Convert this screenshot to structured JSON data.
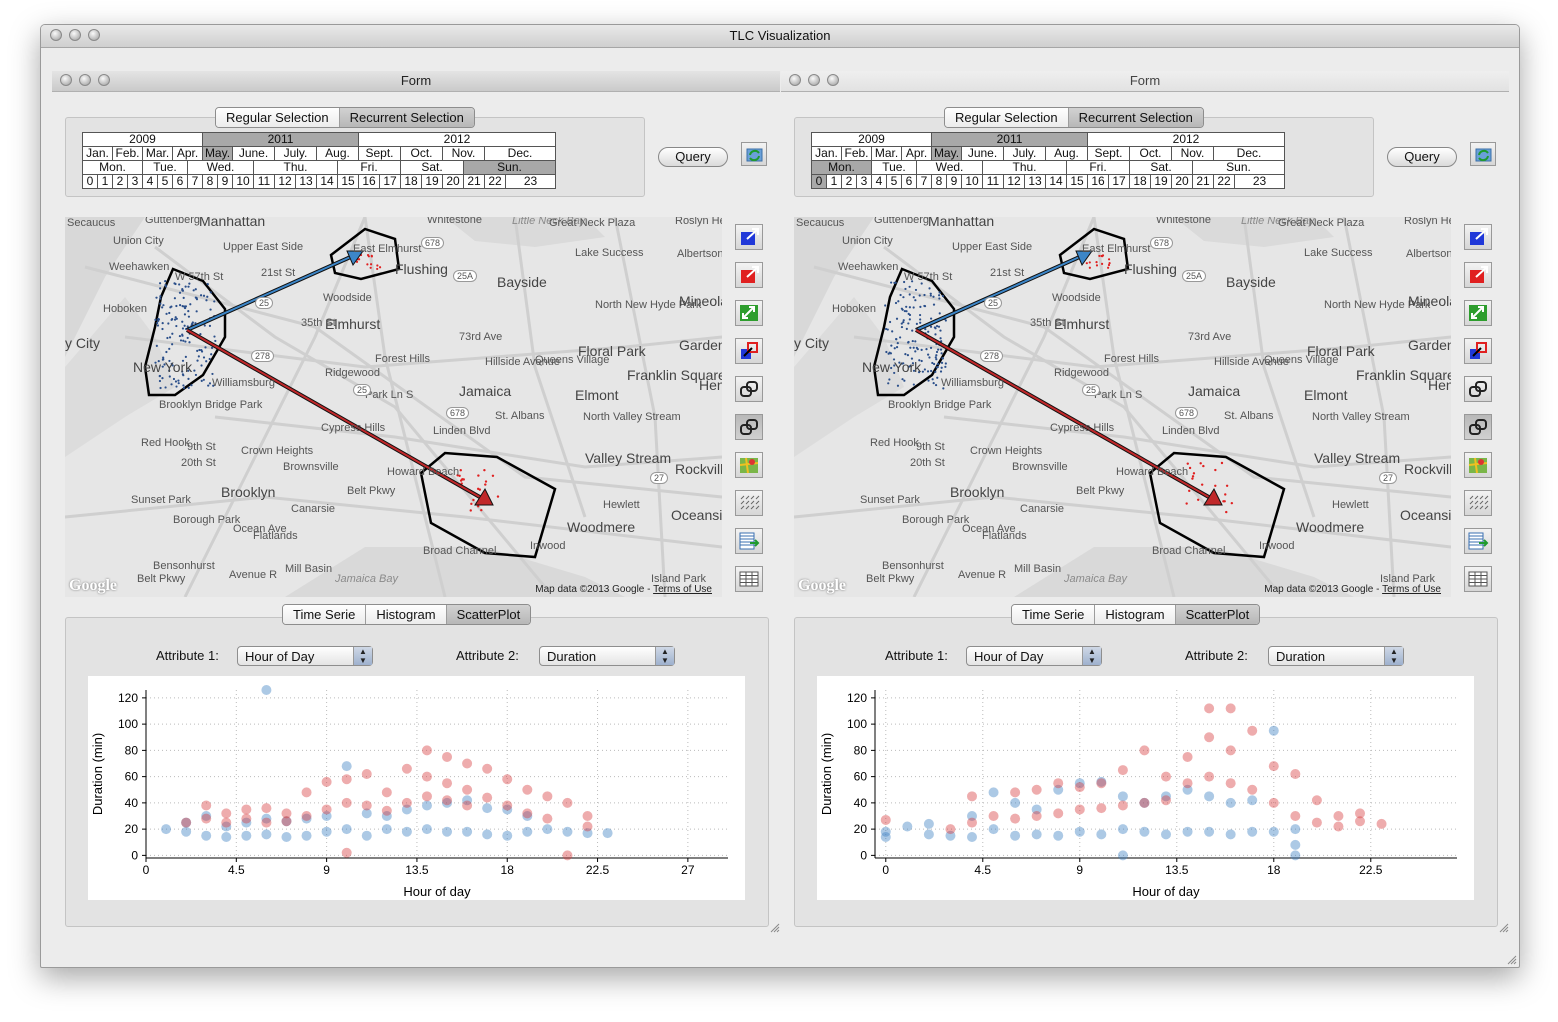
{
  "app": {
    "title": "TLC Visualization"
  },
  "forms": [
    {
      "title": "Form",
      "selection_tabs": [
        "Regular Selection",
        "Recurrent Selection"
      ],
      "active_selection_tab": 1,
      "years": [
        "2009",
        "2011",
        "2012"
      ],
      "selected_years": [
        1
      ],
      "months": [
        "Jan.",
        "Feb.",
        "Mar.",
        "Apr.",
        "May.",
        "June.",
        "July.",
        "Aug.",
        "Sept.",
        "Oct.",
        "Nov.",
        "Dec."
      ],
      "selected_months": [
        4
      ],
      "weekdays": [
        "Mon.",
        "Tue.",
        "Wed.",
        "Thu.",
        "Fri.",
        "Sat.",
        "Sun."
      ],
      "selected_weekdays": [
        6
      ],
      "hours": [
        "0",
        "1",
        "2",
        "3",
        "4",
        "5",
        "6",
        "7",
        "8",
        "9",
        "10",
        "11",
        "12",
        "13",
        "14",
        "15",
        "16",
        "17",
        "18",
        "19",
        "20",
        "21",
        "22",
        "23"
      ],
      "selected_hours": [],
      "query_label": "Query",
      "chart_tabs": [
        "Time Serie",
        "Histogram",
        "ScatterPlot"
      ],
      "active_chart_tab": 2,
      "attribute1_label": "Attribute 1:",
      "attribute1_value": "Hour of Day",
      "attribute2_label": "Attribute 2:",
      "attribute2_value": "Duration",
      "chart_data": {
        "type": "scatter",
        "xlabel": "Hour of day",
        "ylabel": "Duration (min)",
        "xlim": [
          0,
          29
        ],
        "ylim": [
          -2,
          126
        ],
        "xticks": [
          "0",
          "4.5",
          "9",
          "13.5",
          "18",
          "22.5",
          "27"
        ],
        "yticks": [
          "0",
          "20",
          "40",
          "60",
          "80",
          "100",
          "120"
        ],
        "grid": true,
        "series": [
          {
            "color": "#3a7fc1",
            "x": [
              1,
              2,
              2,
              3,
              3,
              4,
              4,
              5,
              5,
              6,
              6,
              6,
              7,
              7,
              8,
              8,
              9,
              9,
              10,
              10,
              11,
              11,
              12,
              12,
              13,
              13,
              14,
              14,
              15,
              15,
              16,
              16,
              17,
              17,
              18,
              18,
              19,
              19,
              20,
              21,
              22,
              23
            ],
            "y": [
              20,
              18,
              25,
              15,
              30,
              14,
              22,
              15,
              25,
              126,
              16,
              28,
              14,
              26,
              15,
              28,
              18,
              30,
              20,
              68,
              15,
              32,
              20,
              30,
              18,
              35,
              20,
              38,
              18,
              40,
              18,
              42,
              16,
              36,
              15,
              35,
              18,
              30,
              20,
              18,
              17,
              17
            ]
          },
          {
            "color": "#d6393c",
            "x": [
              2,
              3,
              3,
              4,
              4,
              5,
              5,
              6,
              6,
              7,
              7,
              8,
              8,
              9,
              9,
              10,
              10,
              10,
              11,
              11,
              12,
              12,
              13,
              13,
              14,
              14,
              14,
              15,
              15,
              15,
              16,
              16,
              16,
              17,
              17,
              18,
              18,
              19,
              19,
              20,
              20,
              21,
              21,
              22,
              22
            ],
            "y": [
              25,
              38,
              28,
              32,
              25,
              35,
              28,
              36,
              25,
              32,
              26,
              48,
              30,
              56,
              35,
              58,
              40,
              2,
              62,
              38,
              48,
              34,
              66,
              40,
              80,
              60,
              45,
              75,
              55,
              42,
              70,
              50,
              38,
              66,
              44,
              58,
              38,
              50,
              32,
              45,
              28,
              40,
              0,
              30,
              22
            ]
          }
        ]
      }
    },
    {
      "title": "Form",
      "selection_tabs": [
        "Regular Selection",
        "Recurrent Selection"
      ],
      "active_selection_tab": 1,
      "years": [
        "2009",
        "2011",
        "2012"
      ],
      "selected_years": [
        1
      ],
      "months": [
        "Jan.",
        "Feb.",
        "Mar.",
        "Apr.",
        "May.",
        "June.",
        "July.",
        "Aug.",
        "Sept.",
        "Oct.",
        "Nov.",
        "Dec."
      ],
      "selected_months": [
        4
      ],
      "weekdays": [
        "Mon.",
        "Tue.",
        "Wed.",
        "Thu.",
        "Fri.",
        "Sat.",
        "Sun."
      ],
      "selected_weekdays": [
        0
      ],
      "hours": [
        "0",
        "1",
        "2",
        "3",
        "4",
        "5",
        "6",
        "7",
        "8",
        "9",
        "10",
        "11",
        "12",
        "13",
        "14",
        "15",
        "16",
        "17",
        "18",
        "19",
        "20",
        "21",
        "22",
        "23"
      ],
      "selected_hours": [
        0
      ],
      "query_label": "Query",
      "chart_tabs": [
        "Time Serie",
        "Histogram",
        "ScatterPlot"
      ],
      "active_chart_tab": 2,
      "attribute1_label": "Attribute 1:",
      "attribute1_value": "Hour of Day",
      "attribute2_label": "Attribute 2:",
      "attribute2_value": "Duration",
      "chart_data": {
        "type": "scatter",
        "xlabel": "Hour of day",
        "ylabel": "Duration (min)",
        "xlim": [
          -0.5,
          26.5
        ],
        "ylim": [
          -2,
          126
        ],
        "xticks": [
          "0",
          "4.5",
          "9",
          "13.5",
          "18",
          "22.5"
        ],
        "yticks": [
          "0",
          "20",
          "40",
          "60",
          "80",
          "100",
          "120"
        ],
        "grid": true,
        "series": [
          {
            "color": "#3a7fc1",
            "x": [
              0,
              0,
              1,
              2,
              2,
              3,
              4,
              4,
              5,
              5,
              6,
              6,
              7,
              7,
              8,
              8,
              9,
              9,
              10,
              10,
              11,
              11,
              11,
              12,
              12,
              13,
              13,
              14,
              14,
              15,
              15,
              16,
              16,
              17,
              17,
              18,
              18,
              19,
              19,
              19
            ],
            "y": [
              18,
              14,
              22,
              24,
              16,
              15,
              14,
              30,
              48,
              20,
              15,
              40,
              16,
              35,
              15,
              50,
              18,
              55,
              16,
              56,
              0,
              20,
              45,
              18,
              40,
              16,
              45,
              18,
              50,
              18,
              45,
              16,
              40,
              18,
              42,
              95,
              18,
              20,
              8,
              0
            ]
          },
          {
            "color": "#d6393c",
            "x": [
              0,
              3,
              4,
              4,
              5,
              6,
              6,
              7,
              7,
              8,
              8,
              9,
              9,
              10,
              10,
              11,
              11,
              12,
              12,
              13,
              13,
              14,
              14,
              15,
              15,
              15,
              16,
              16,
              16,
              17,
              17,
              18,
              18,
              19,
              19,
              20,
              20,
              21,
              21,
              22,
              22,
              23
            ],
            "y": [
              27,
              20,
              45,
              25,
              30,
              48,
              28,
              50,
              30,
              55,
              32,
              52,
              35,
              55,
              36,
              65,
              38,
              80,
              40,
              60,
              42,
              75,
              55,
              112,
              90,
              60,
              112,
              80,
              55,
              95,
              50,
              68,
              40,
              62,
              30,
              42,
              25,
              30,
              22,
              32,
              26,
              24
            ]
          }
        ]
      }
    }
  ],
  "map": {
    "labels": [
      "Secaucus",
      "Guttenberg",
      "Manhattan",
      "Whitestone",
      "Little Neck Bay",
      "Great Neck Plaza",
      "Roslyn Heights",
      "Union City",
      "Upper East Side",
      "East Elmhurst",
      "Lake Success",
      "Albertson",
      "Weehawken",
      "Flushing",
      "Bayside",
      "Hoboken",
      "Woodside",
      "North New Hyde Park",
      "Mineola",
      "y City",
      "Elmhurst",
      "Garden",
      "New York",
      "Forest Hills",
      "Floral Park",
      "Williamsburg",
      "Ridgewood",
      "Queens Village",
      "Franklin Square",
      "Hen",
      "Jamaica",
      "Elmont",
      "Brooklyn Bridge Park",
      "St. Albans",
      "North Valley Stream",
      "Red Hook",
      "Cypress Hills",
      "Crown Heights",
      "Brownsville",
      "Valley Stream",
      "Rockville Centre",
      "Howard Beach",
      "Brooklyn",
      "Hewlett",
      "Sunset Park",
      "Canarsie",
      "Oceanside",
      "Borough Park",
      "Flatlands",
      "Woodmere",
      "Inwood",
      "Broad Channel",
      "Bensonhurst",
      "Mill Basin",
      "Jamaica Bay",
      "Island Park",
      "Avenue R",
      "Belt Pkwy",
      "Linden Blvd",
      "Park Ln S",
      "Hillside Avenue",
      "73rd Ave",
      "W 57th St",
      "21st St",
      "35th St",
      "9th St",
      "20th St",
      "Ocean Ave",
      "Belt Pkwy"
    ],
    "roads": [
      "678",
      "25A",
      "25",
      "278",
      "25",
      "678",
      "27"
    ],
    "map_data": "Map data ©2013 Google",
    "terms": "Terms of Use",
    "logo": "Google"
  },
  "tool_icons": [
    "select-blue-icon",
    "select-red-icon",
    "swap-arrows-icon",
    "link-blue-red-icon",
    "link-regions-icon",
    "link-regions-pressed-icon",
    "map-layer-icon",
    "vector-field-icon",
    "table-export-icon",
    "grid-table-icon"
  ]
}
